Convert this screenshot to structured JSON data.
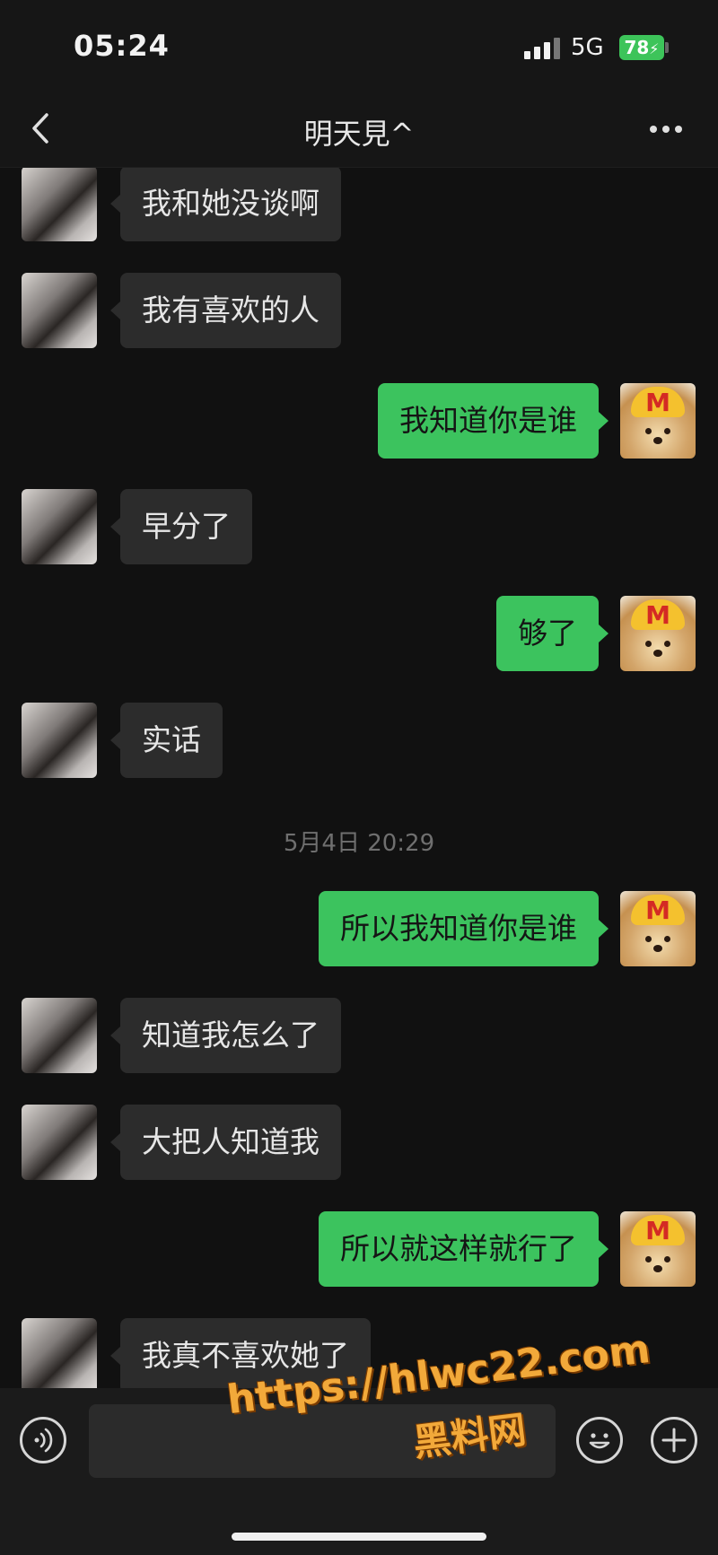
{
  "status_bar": {
    "time": "05:24",
    "network": "5G",
    "battery": "78"
  },
  "header": {
    "title": "明天見^"
  },
  "messages": [
    {
      "side": "in",
      "text": "我和她没谈啊"
    },
    {
      "side": "in",
      "text": "我有喜欢的人"
    },
    {
      "side": "out",
      "text": "我知道你是谁"
    },
    {
      "side": "in",
      "text": "早分了"
    },
    {
      "side": "out",
      "text": "够了"
    },
    {
      "side": "in",
      "text": "实话"
    },
    {
      "side": "out",
      "text": "所以我知道你是谁"
    },
    {
      "side": "in",
      "text": "知道我怎么了"
    },
    {
      "side": "in",
      "text": "大把人知道我"
    },
    {
      "side": "out",
      "text": "所以就这样就行了"
    },
    {
      "side": "in",
      "text": "我真不喜欢她了"
    }
  ],
  "timestamp": "5月4日 20:29",
  "self_avatar_logo": "M",
  "watermark": {
    "url": "https://hlwc22.com",
    "name": "黑料网"
  },
  "colors": {
    "outgoing_bubble": "#3cc35e",
    "incoming_bubble": "#2c2c2c",
    "background": "#111111"
  },
  "icons": [
    "back-arrow-icon",
    "more-dots-icon",
    "voice-icon",
    "emoji-icon",
    "plus-icon"
  ]
}
